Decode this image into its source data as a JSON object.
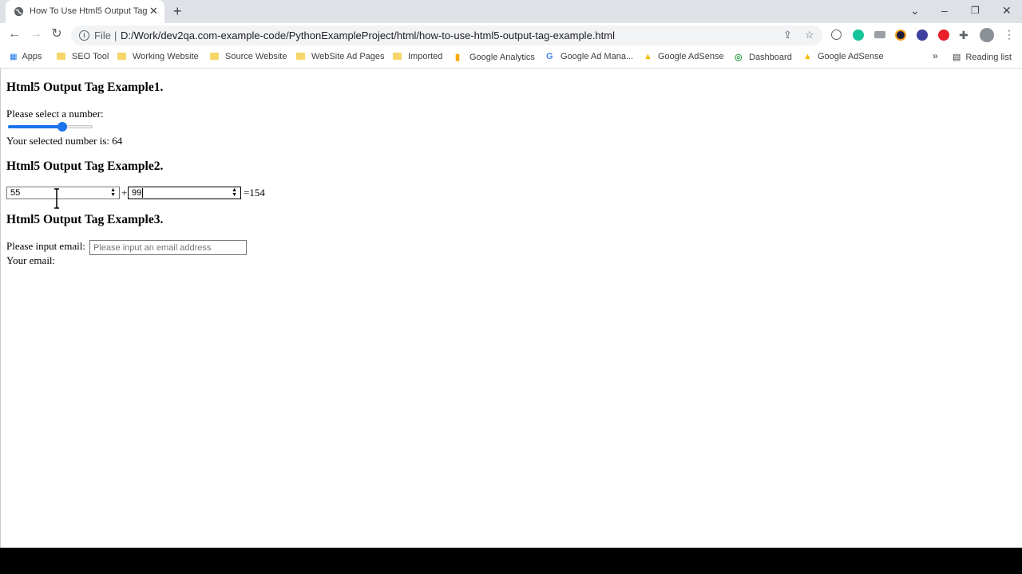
{
  "browser": {
    "tab_title": "How To Use Html5 Output Tag",
    "url_scheme": "File",
    "url": "D:/Work/dev2qa.com-example-code/PythonExampleProject/html/how-to-use-html5-output-tag-example.html"
  },
  "bookmarks": {
    "apps": "Apps",
    "items": [
      "SEO Tool",
      "Working Website",
      "Source Website",
      "WebSite Ad Pages",
      "Imported",
      "Google Analytics",
      "Google Ad Mana...",
      "Google AdSense",
      "Dashboard",
      "Google AdSense"
    ],
    "overflow": "»",
    "reading_list": "Reading list"
  },
  "page": {
    "example1": {
      "heading": "Html5 Output Tag Example1.",
      "prompt": "Please select a number:",
      "slider_value": 64,
      "slider_min": 0,
      "slider_max": 100,
      "result": "Your selected number is: 64"
    },
    "example2": {
      "heading": "Html5 Output Tag Example2.",
      "a": "55",
      "plus": "+",
      "b": "99",
      "result": "=154"
    },
    "example3": {
      "heading": "Html5 Output Tag Example3.",
      "label": "Please input email:",
      "placeholder": "Please input an email address",
      "output": "Your email:"
    }
  },
  "colors": {
    "accent": "#1a73e8",
    "tabstrip": "#dee1e6"
  }
}
